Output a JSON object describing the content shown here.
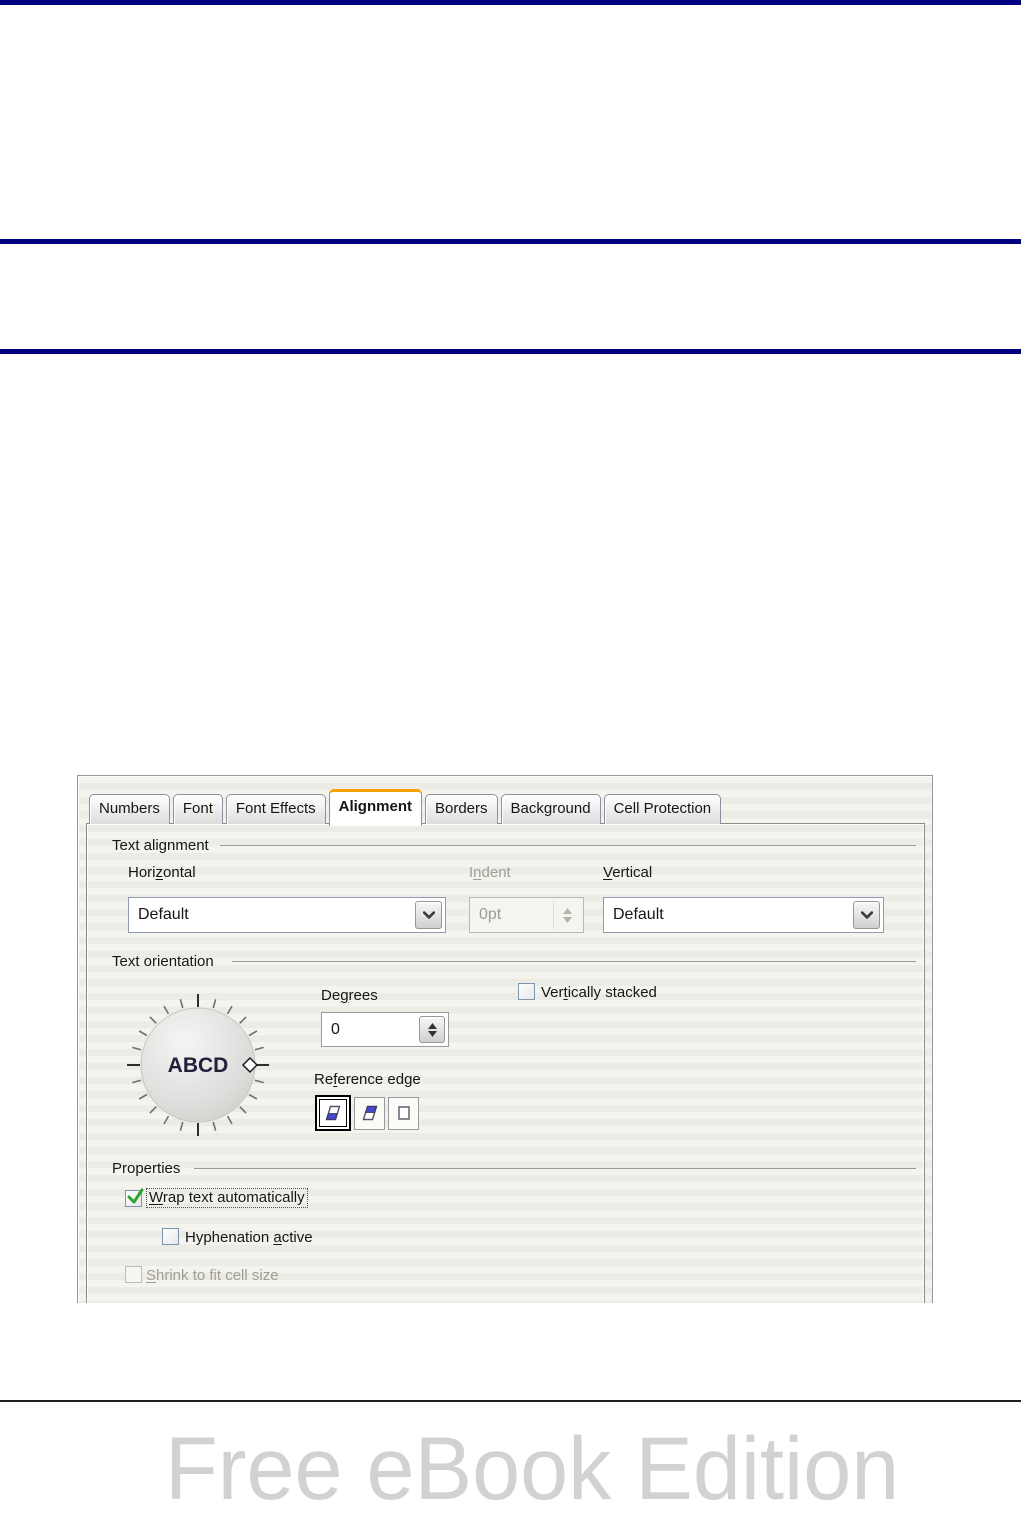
{
  "page": {
    "watermark": "Free eBook Edition",
    "colors": {
      "rule_navy": "#000080",
      "footer_rule": "#1f1f1f",
      "watermark_gray": "#d2d2d2",
      "tab_accent_orange": "#f9a008",
      "check_green": "#2ea233",
      "reference_edge_blue": "#4646cf"
    }
  },
  "dialog": {
    "tabs": [
      {
        "label": "Numbers",
        "selected": false
      },
      {
        "label": "Font",
        "selected": false
      },
      {
        "label": "Font Effects",
        "selected": false
      },
      {
        "label": "Alignment",
        "selected": true
      },
      {
        "label": "Borders",
        "selected": false
      },
      {
        "label": "Background",
        "selected": false
      },
      {
        "label": "Cell Protection",
        "selected": false
      }
    ],
    "text_alignment": {
      "group_label": "Text alignment",
      "horizontal": {
        "label": {
          "pre": "Hori",
          "accel": "z",
          "post": "ontal"
        },
        "value": "Default",
        "enabled": true
      },
      "indent": {
        "label": {
          "pre": "I",
          "accel": "n",
          "post": "dent"
        },
        "value": "0pt",
        "enabled": false
      },
      "vertical": {
        "label": {
          "pre": "",
          "accel": "V",
          "post": "ertical"
        },
        "value": "Default",
        "enabled": true
      }
    },
    "text_orientation": {
      "group_label": "Text orientation",
      "dial_text": "ABCD",
      "degrees": {
        "label": {
          "pre": "De",
          "accel": "g",
          "post": "rees"
        },
        "value": "0"
      },
      "vertically_stacked": {
        "label": {
          "pre": "Ver",
          "accel": "t",
          "post": "ically stacked"
        },
        "checked": false
      },
      "reference_edge": {
        "label": {
          "pre": "Re",
          "accel": "f",
          "post": "erence edge"
        },
        "selected_option": "text-extension-from-lower-cell-border"
      }
    },
    "properties": {
      "group_label": "Properties",
      "wrap_text": {
        "label": {
          "pre": "",
          "accel": "W",
          "post": "rap text automatically"
        },
        "checked": true,
        "focused": true
      },
      "hyphenation": {
        "label": {
          "pre": "Hyphenation ",
          "accel": "a",
          "post": "ctive"
        },
        "checked": false
      },
      "shrink": {
        "label": {
          "pre": "",
          "accel": "S",
          "post": "hrink to fit cell size"
        },
        "checked": false,
        "enabled": false
      }
    }
  }
}
